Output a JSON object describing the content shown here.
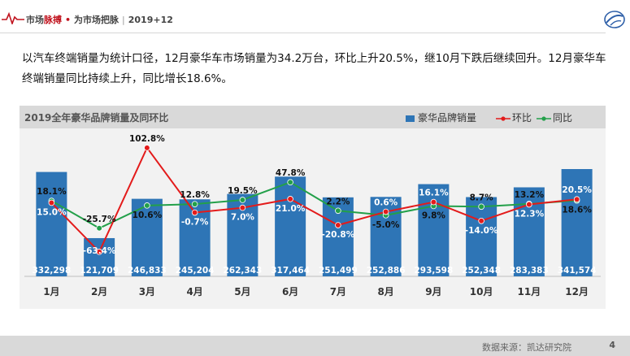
{
  "header": {
    "brand_a": "市场",
    "brand_b": "脉搏",
    "brand_c": "为市场把脉",
    "period": "2019+12"
  },
  "intro_text": "以汽车终端销量为统计口径，12月豪华车市场销量为34.2万台，环比上升20.5%，继10月下跌后继续回升。12月豪华车终端销量同比持续上升，同比增长18.6%。",
  "footer": {
    "source": "数据来源：凯达研究院",
    "page": "4"
  },
  "colors": {
    "bar": "#2e75b6",
    "mom_line": "#e31b1b",
    "yoy_line": "#23a04a",
    "panel_bg": "#f2f2f2",
    "title_bar": "#d9d9d9",
    "accent": "#c0121d"
  },
  "chart_data": {
    "type": "bar",
    "title": "2019全年豪华品牌销量及同环比",
    "legend_position": "top-right",
    "categories": [
      "1月",
      "2月",
      "3月",
      "4月",
      "5月",
      "6月",
      "7月",
      "8月",
      "9月",
      "10月",
      "11月",
      "12月"
    ],
    "series": [
      {
        "name": "豪华品牌销量",
        "type": "bar",
        "values": [
          332298,
          121709,
          246833,
          245204,
          262343,
          317464,
          251499,
          252886,
          293598,
          252348,
          283383,
          341574
        ],
        "labels": [
          "332,298",
          "121,709",
          "246,833",
          "245,204",
          "262,343",
          "317,464",
          "251,499",
          "252,886",
          "293,598",
          "252,348",
          "283,383",
          "341,574"
        ]
      },
      {
        "name": "环比",
        "type": "line",
        "values": [
          15.0,
          -63.4,
          102.8,
          -0.7,
          7.0,
          21.0,
          -20.8,
          0.6,
          16.1,
          -14.0,
          12.3,
          20.5
        ],
        "labels": [
          "15.0%",
          "-63.4%",
          "102.8%",
          "-0.7%",
          "7.0%",
          "21.0%",
          "-20.8%",
          "0.6%",
          "16.1%",
          "-14.0%",
          "12.3%",
          "20.5%"
        ]
      },
      {
        "name": "同比",
        "type": "line",
        "values": [
          18.1,
          -25.7,
          10.6,
          12.8,
          19.5,
          47.8,
          2.2,
          -5.0,
          9.8,
          8.7,
          13.2,
          18.6
        ],
        "labels": [
          "18.1%",
          "-25.7%",
          "10.6%",
          "12.8%",
          "19.5%",
          "47.8%",
          "2.2%",
          "-5.0%",
          "9.8%",
          "8.7%",
          "13.2%",
          "18.6%"
        ]
      }
    ]
  }
}
